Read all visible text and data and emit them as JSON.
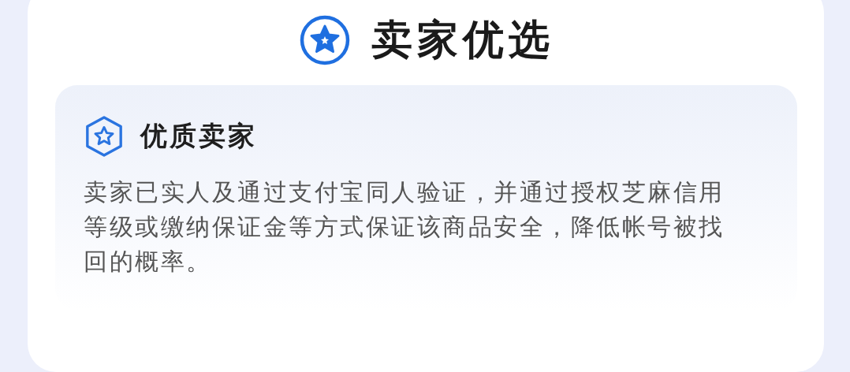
{
  "card": {
    "title": "卖家优选",
    "feature": {
      "title": "优质卖家",
      "description": "卖家已实人及通过支付宝同人验证，并通过授权芝麻信用等级或缴纳保证金等方式保证该商品安全，降低帐号被找回的概率。"
    }
  }
}
